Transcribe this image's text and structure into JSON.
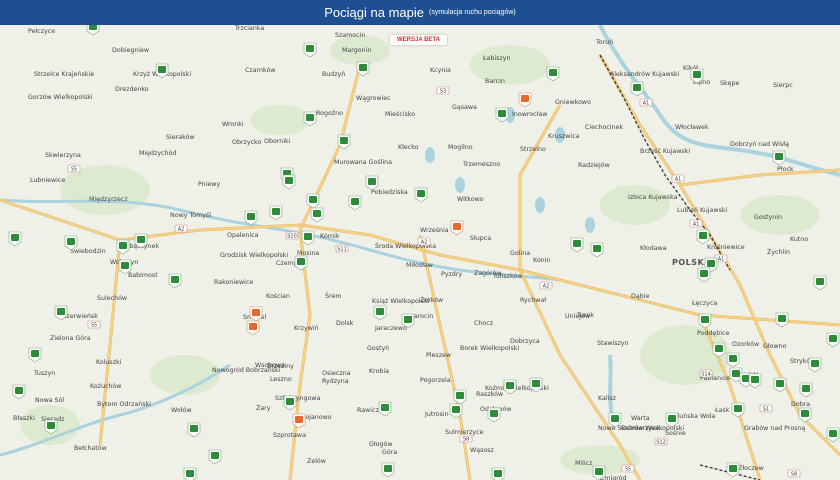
{
  "header": {
    "title": "Pociągi na mapie",
    "subtitle": "(symulacja ruchu pociągów)"
  },
  "badge": {
    "label": "WERSJA BETA"
  },
  "map": {
    "country_label": "POLSKA",
    "colors": {
      "header": "#1d4f91",
      "train_green": "#2e8b3a",
      "train_orange": "#e36a2e",
      "road": "#f5d48a",
      "water": "#aad3df",
      "forest": "#d6e7c6",
      "rail": "#333333"
    },
    "places": [
      {
        "n": "Pełczyce"
      },
      {
        "n": "Dobiegniew"
      },
      {
        "n": "Strzelce Krajeńskie"
      },
      {
        "n": "Krzyż Wielkopolski"
      },
      {
        "n": "Drezdenko"
      },
      {
        "n": "Trzcianka"
      },
      {
        "n": "Czarnków"
      },
      {
        "n": "Szamocin"
      },
      {
        "n": "Margonin"
      },
      {
        "n": "Budzyń"
      },
      {
        "n": "Kcynia"
      },
      {
        "n": "Łabiszyn"
      },
      {
        "n": "Toruń"
      },
      {
        "n": "Aleksandrów Kujawski"
      },
      {
        "n": "Kikół"
      },
      {
        "n": "Lipno"
      },
      {
        "n": "Skępe"
      },
      {
        "n": "Sierpc"
      },
      {
        "n": "Gorzów Wielkopolski"
      },
      {
        "n": "Wronki"
      },
      {
        "n": "Obrzycko"
      },
      {
        "n": "Rogoźno"
      },
      {
        "n": "Wągrowiec"
      },
      {
        "n": "Mieścisko"
      },
      {
        "n": "Gąsawa"
      },
      {
        "n": "Barcin"
      },
      {
        "n": "Inowrocław"
      },
      {
        "n": "Gniewkowo"
      },
      {
        "n": "Ciechocinek"
      },
      {
        "n": "Włocławek"
      },
      {
        "n": "Dobrzyń nad Wisłą"
      },
      {
        "n": "Skwierzyna"
      },
      {
        "n": "Międzychód"
      },
      {
        "n": "Sieraków"
      },
      {
        "n": "Oborniki"
      },
      {
        "n": "Murowana Goślina"
      },
      {
        "n": "Kłecko"
      },
      {
        "n": "Mogilno"
      },
      {
        "n": "Strzelno"
      },
      {
        "n": "Kruszwica"
      },
      {
        "n": "Radziejów"
      },
      {
        "n": "Brześć Kujawski"
      },
      {
        "n": "Płock"
      },
      {
        "n": "Trzemeszno"
      },
      {
        "n": "Lubniewice"
      },
      {
        "n": "Pniewy"
      },
      {
        "n": "Pobiedziska"
      },
      {
        "n": "Witkowo"
      },
      {
        "n": "Izbica Kujawska"
      },
      {
        "n": "Lubień Kujawski"
      },
      {
        "n": "Gostynin"
      },
      {
        "n": "Międzyrzecz"
      },
      {
        "n": "Nowy Tomyśl"
      },
      {
        "n": "Opalenica"
      },
      {
        "n": "Czempiń"
      },
      {
        "n": "Buk"
      },
      {
        "n": "Mosina"
      },
      {
        "n": "Kórnik"
      },
      {
        "n": "Środa Wielkopolska"
      },
      {
        "n": "Września"
      },
      {
        "n": "Słupca"
      },
      {
        "n": "Golina"
      },
      {
        "n": "Konin"
      },
      {
        "n": "Kłodawa"
      },
      {
        "n": "Krośniewice"
      },
      {
        "n": "Żychlin"
      },
      {
        "n": "Kutno"
      },
      {
        "n": "Świebodzin"
      },
      {
        "n": "Zbąszynek"
      },
      {
        "n": "Babimost"
      },
      {
        "n": "Wolsztyn"
      },
      {
        "n": "Grodzisk Wielkopolski"
      },
      {
        "n": "Rakoniewice"
      },
      {
        "n": "Kościan"
      },
      {
        "n": "Śrem"
      },
      {
        "n": "Książ Wielkopolski"
      },
      {
        "n": "Miłosław"
      },
      {
        "n": "Pyzdry"
      },
      {
        "n": "Zagórów"
      },
      {
        "n": "Tuliszków"
      },
      {
        "n": "Turek"
      },
      {
        "n": "Dąbie"
      },
      {
        "n": "Łęczyca"
      },
      {
        "n": "Sulechów"
      },
      {
        "n": "Czerwieńsk"
      },
      {
        "n": "Zielona Góra"
      },
      {
        "n": "Smigiel"
      },
      {
        "n": "Krzywiń"
      },
      {
        "n": "Dolsk"
      },
      {
        "n": "Jaraczewo"
      },
      {
        "n": "Jarocin"
      },
      {
        "n": "Żerków"
      },
      {
        "n": "Chocz"
      },
      {
        "n": "Rychwał"
      },
      {
        "n": "Uniejów"
      },
      {
        "n": "Poddębice"
      },
      {
        "n": "Ozorków"
      },
      {
        "n": "Głowno"
      },
      {
        "n": "Stryków"
      },
      {
        "n": "Brzeziny"
      },
      {
        "n": "Osieczna"
      },
      {
        "n": "Gostyń"
      },
      {
        "n": "Borek Wielkopolski"
      },
      {
        "n": "Pleszew"
      },
      {
        "n": "Dobrzyca"
      },
      {
        "n": "Stawiszyn"
      },
      {
        "n": "Dobra"
      },
      {
        "n": "Koluszki"
      },
      {
        "n": "Nowogród Bobrzański"
      },
      {
        "n": "Wschowa"
      },
      {
        "n": "Leszno"
      },
      {
        "n": "Rydzyna"
      },
      {
        "n": "Krobia"
      },
      {
        "n": "Pogorzela"
      },
      {
        "n": "Koźmin Wielkopolski"
      },
      {
        "n": "Kalisz"
      },
      {
        "n": "Warta"
      },
      {
        "n": "Zduńska Wola"
      },
      {
        "n": "Łask"
      },
      {
        "n": "Pabianice"
      },
      {
        "n": "Łódź"
      },
      {
        "n": "Tuszyn"
      },
      {
        "n": "Kożuchów"
      },
      {
        "n": "Bytom Odrzański"
      },
      {
        "n": "Nowa Sól"
      },
      {
        "n": "Szlichtyngowa"
      },
      {
        "n": "Bojanowo"
      },
      {
        "n": "Rawicz"
      },
      {
        "n": "Jutrosin"
      },
      {
        "n": "Sulmierzyce"
      },
      {
        "n": "Raszków"
      },
      {
        "n": "Odolanów"
      },
      {
        "n": "Ostrów Wielkopolski"
      },
      {
        "n": "Nowe Skalmierzyce"
      },
      {
        "n": "Błaszki"
      },
      {
        "n": "Sieradz"
      },
      {
        "n": "Wołów"
      },
      {
        "n": "Żary"
      },
      {
        "n": "Szprotawa"
      },
      {
        "n": "Głogów"
      },
      {
        "n": "Góra"
      },
      {
        "n": "Wąsosz"
      },
      {
        "n": "Milicz"
      },
      {
        "n": "Sośnie"
      },
      {
        "n": "Grabów nad Prosną"
      },
      {
        "n": "Złoczew"
      },
      {
        "n": "Zelów"
      },
      {
        "n": "Bełchatów"
      },
      {
        "n": "Zmigród"
      },
      {
        "n": "Przemków"
      },
      {
        "n": "Wieruszów"
      }
    ],
    "route_labels": [
      "A2",
      "A2",
      "A2",
      "A1",
      "A1",
      "A1",
      "A1",
      "S5",
      "S5",
      "S11",
      "S8",
      "S3",
      "S10",
      "S14",
      "S8",
      "S12",
      "S5",
      "S1"
    ]
  }
}
